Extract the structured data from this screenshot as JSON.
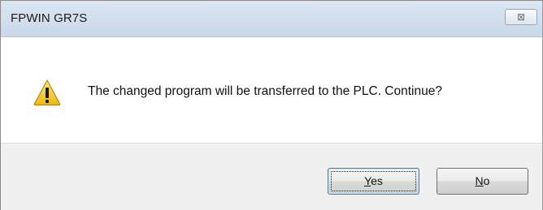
{
  "window": {
    "title": "FPWIN GR7S",
    "close_glyph": "⊠"
  },
  "dialog": {
    "icon": "warning-icon",
    "message": "The changed program will be transferred to the PLC. Continue?"
  },
  "buttons": {
    "yes": {
      "mnemonic": "Y",
      "rest": "es"
    },
    "no": {
      "mnemonic": "N",
      "rest": "o"
    }
  },
  "colors": {
    "titlebar": "#c9d8ea",
    "footer": "#f0f0f0",
    "default_button_border": "#3c7fb1",
    "warning_yellow": "#f7cf2d"
  }
}
